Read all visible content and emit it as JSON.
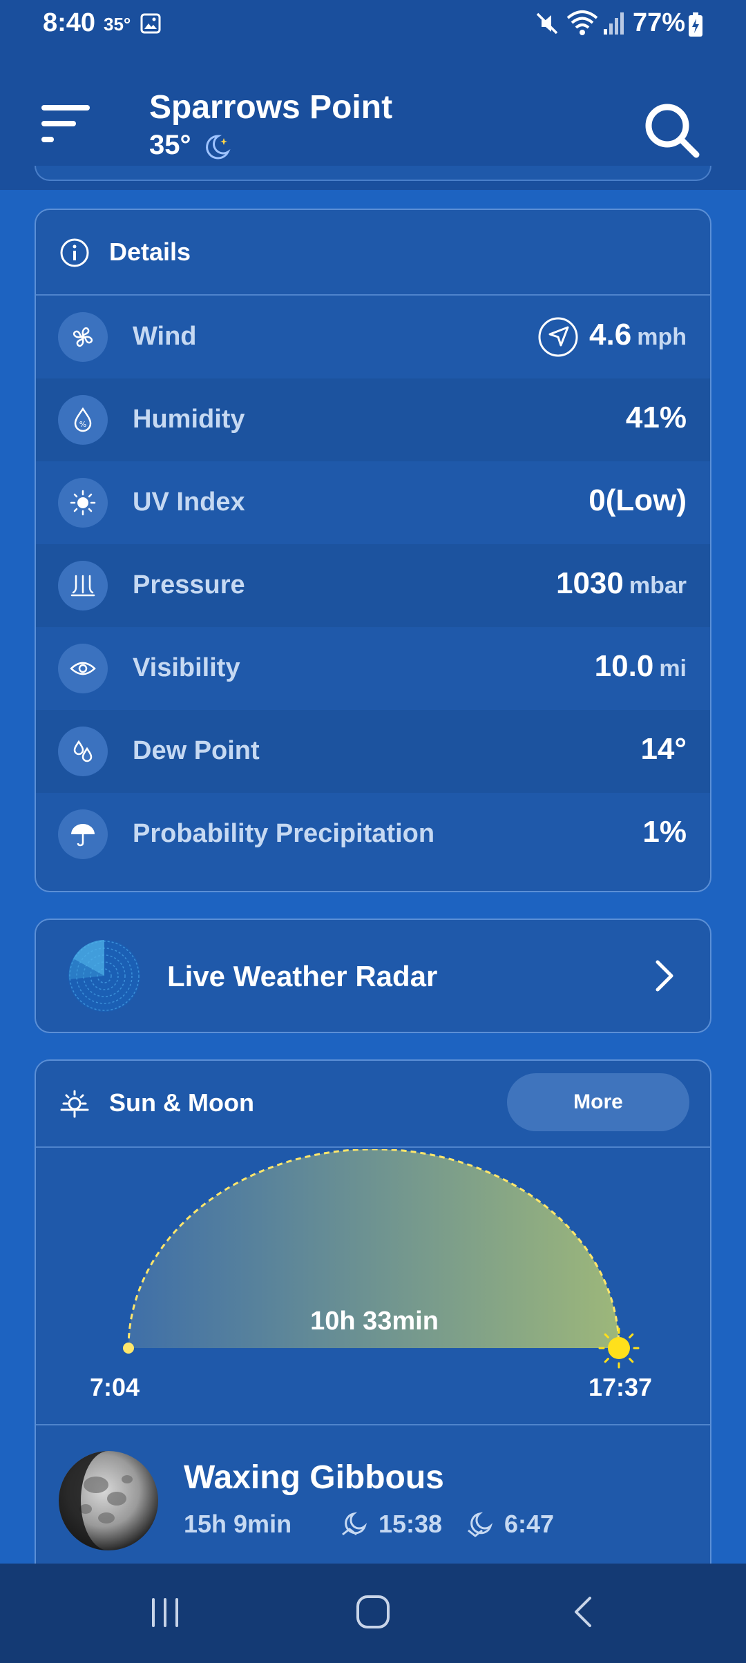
{
  "status_bar": {
    "time": "8:40",
    "temp": "35°",
    "battery": "77%"
  },
  "header": {
    "city": "Sparrows Point",
    "temp": "35°"
  },
  "details": {
    "title": "Details",
    "rows": [
      {
        "label": "Wind",
        "value": "4.6",
        "unit": "mph",
        "icon": "fan-icon"
      },
      {
        "label": "Humidity",
        "value": "41%",
        "unit": "",
        "icon": "humidity-drop-icon"
      },
      {
        "label": "UV Index",
        "value": "0(Low)",
        "unit": "",
        "icon": "sun-icon"
      },
      {
        "label": "Pressure",
        "value": "1030",
        "unit": "mbar",
        "icon": "pressure-icon"
      },
      {
        "label": "Visibility",
        "value": "10.0",
        "unit": "mi",
        "icon": "eye-icon"
      },
      {
        "label": "Dew Point",
        "value": "14°",
        "unit": "",
        "icon": "dew-point-icon"
      },
      {
        "label": "Probability Precipitation",
        "value": "1%",
        "unit": "",
        "icon": "umbrella-icon"
      }
    ]
  },
  "radar": {
    "title": "Live Weather Radar"
  },
  "sun_moon": {
    "title": "Sun & Moon",
    "more_label": "More",
    "day_length": "10h 33min",
    "sunrise": "7:04",
    "sunset": "17:37",
    "day_progress": 1.0,
    "moon_phase": "Waxing Gibbous",
    "moon_duration": "15h 9min",
    "moonrise": "15:38",
    "moonset": "6:47"
  },
  "colors": {
    "background": "#1d63c1",
    "header": "#1a4f9d",
    "card": "#1f59aa",
    "sun": "#ffe01b"
  }
}
